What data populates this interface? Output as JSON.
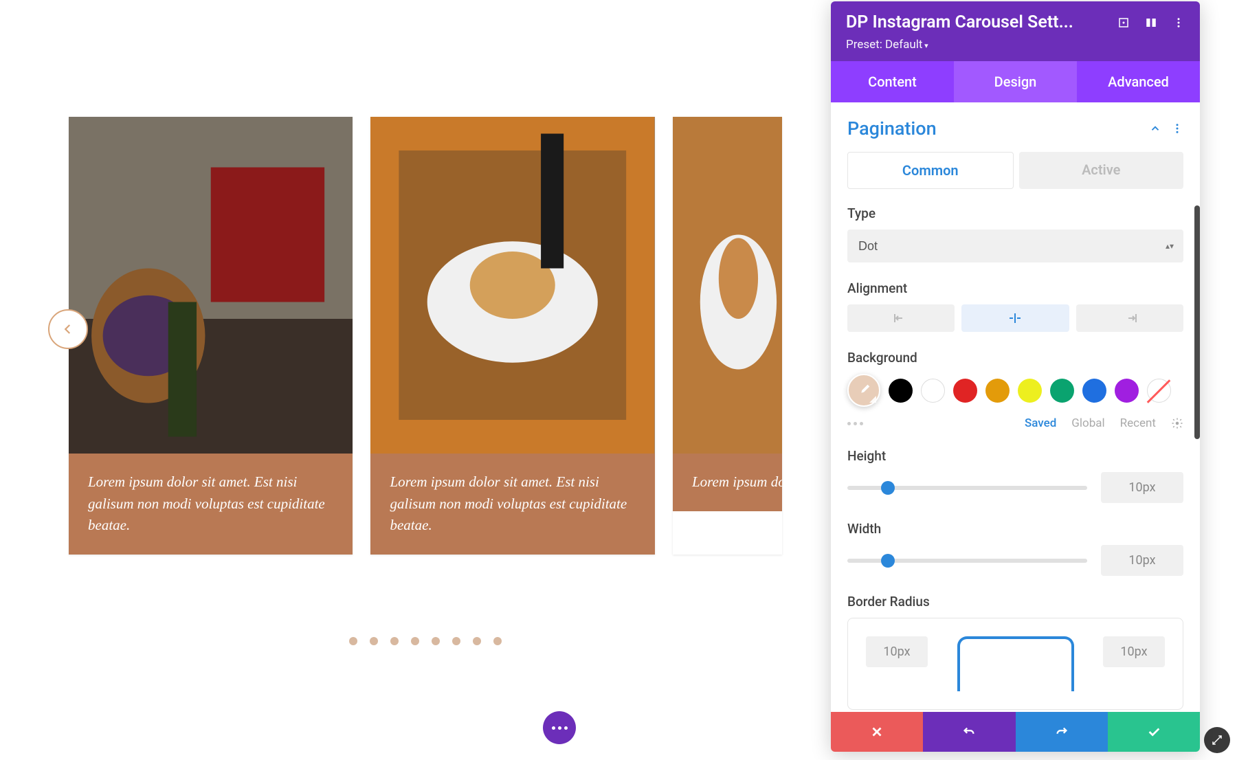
{
  "panel": {
    "title": "DP Instagram Carousel Sett...",
    "preset": "Preset: Default",
    "tabs": {
      "content": "Content",
      "design": "Design",
      "advanced": "Advanced"
    },
    "section": {
      "title": "Pagination"
    },
    "subtabs": {
      "common": "Common",
      "active": "Active"
    },
    "fields": {
      "type_label": "Type",
      "type_value": "Dot",
      "alignment_label": "Alignment",
      "background_label": "Background",
      "height_label": "Height",
      "height_value": "10px",
      "width_label": "Width",
      "width_value": "10px",
      "radius_label": "Border Radius",
      "radius_tl": "10px",
      "radius_tr": "10px"
    },
    "swatch_links": {
      "saved": "Saved",
      "global": "Global",
      "recent": "Recent"
    },
    "swatches": [
      {
        "color": "#000000"
      },
      {
        "color": "#ffffff",
        "white": true
      },
      {
        "color": "#e02424"
      },
      {
        "color": "#e39b0a"
      },
      {
        "color": "#edef1f"
      },
      {
        "color": "#0aa36f"
      },
      {
        "color": "#1f6fe0"
      },
      {
        "color": "#a01fe0"
      }
    ]
  },
  "carousel": {
    "cards": [
      {
        "caption": "Lorem ipsum dolor sit amet. Est nisi galisum non modi voluptas est cupiditate beatae."
      },
      {
        "caption": "Lorem ipsum dolor sit amet. Est nisi galisum non modi voluptas est cupiditate beatae."
      },
      {
        "caption": "Lorem ipsum dolor sit amet. Est nisi galisum non modi voluptas est cupiditate beatae."
      }
    ],
    "dot_count": 8
  }
}
